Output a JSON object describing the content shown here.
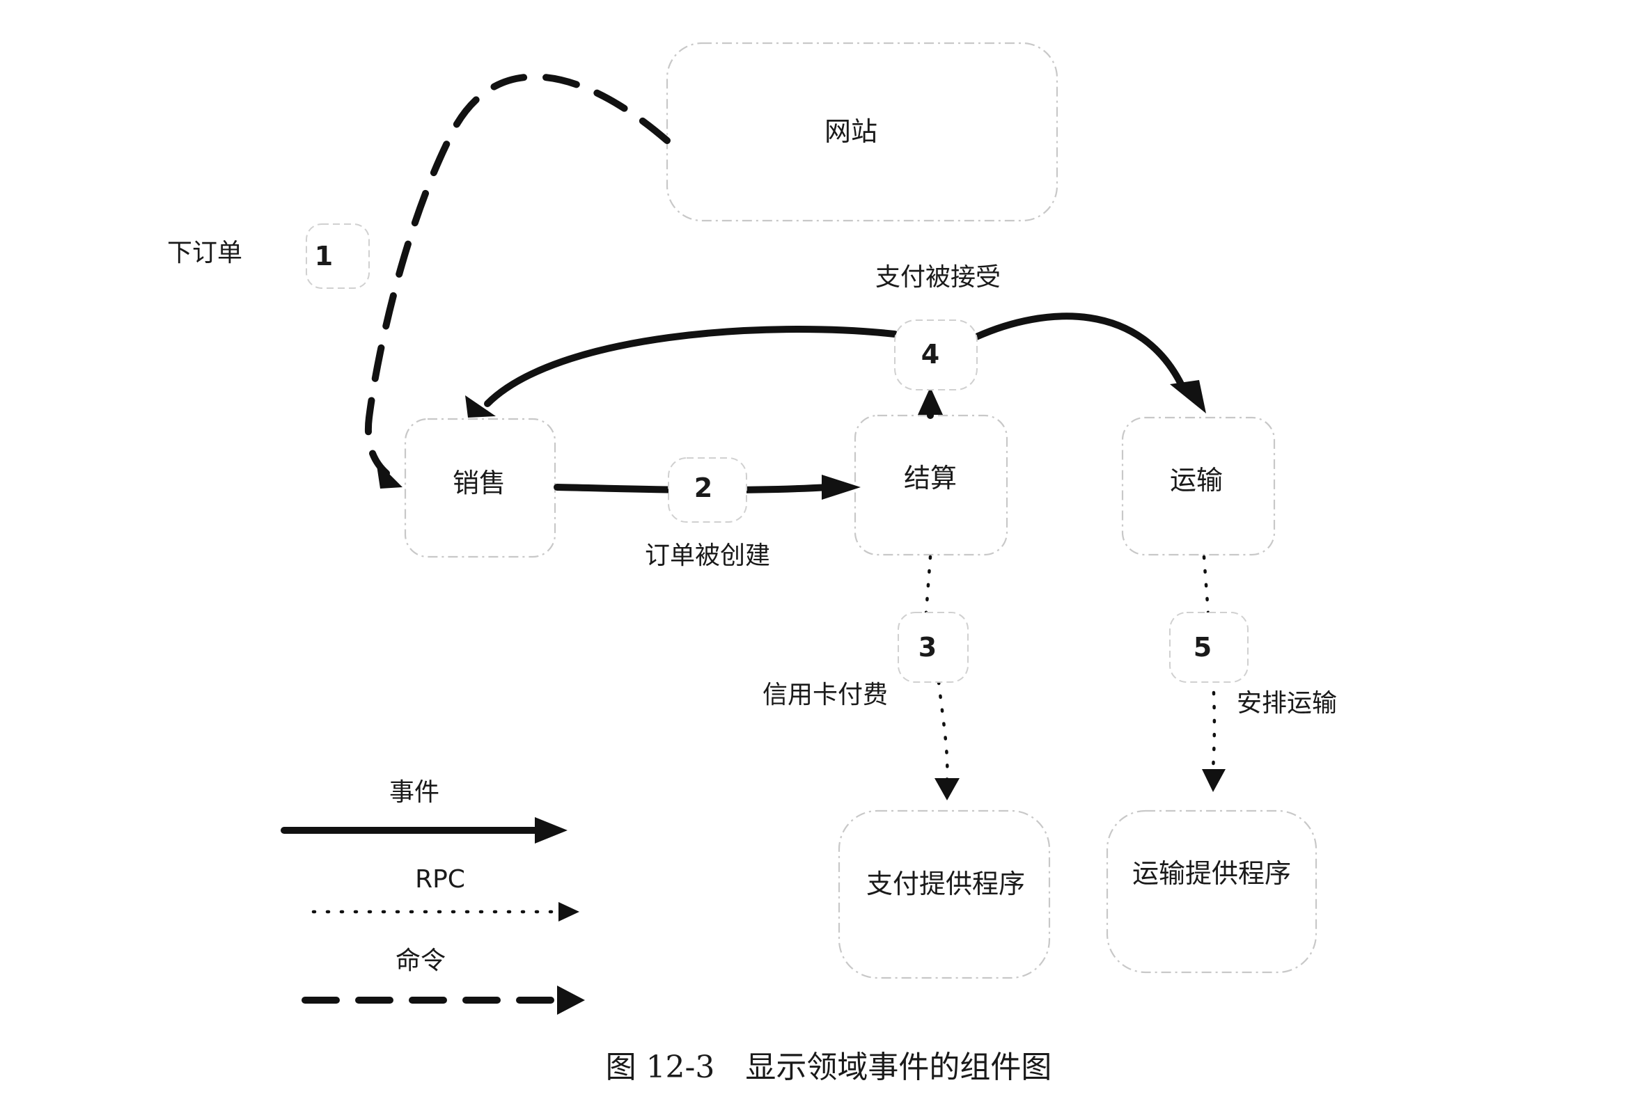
{
  "nodes": {
    "website": "网站",
    "sales": "销售",
    "checkout": "结算",
    "shipping": "运输",
    "payment_provider": "支付提供程序",
    "shipping_provider": "运输提供程序"
  },
  "steps": {
    "s1": {
      "number": "1",
      "label": "下订单"
    },
    "s2": {
      "number": "2",
      "label": "订单被创建"
    },
    "s3": {
      "number": "3",
      "label": "信用卡付费"
    },
    "s4": {
      "number": "4",
      "label": "支付被接受"
    },
    "s5": {
      "number": "5",
      "label": "安排运输"
    }
  },
  "legend": {
    "event": "事件",
    "rpc": "RPC",
    "command": "命令"
  },
  "caption": "图 12-3　显示领域事件的组件图"
}
